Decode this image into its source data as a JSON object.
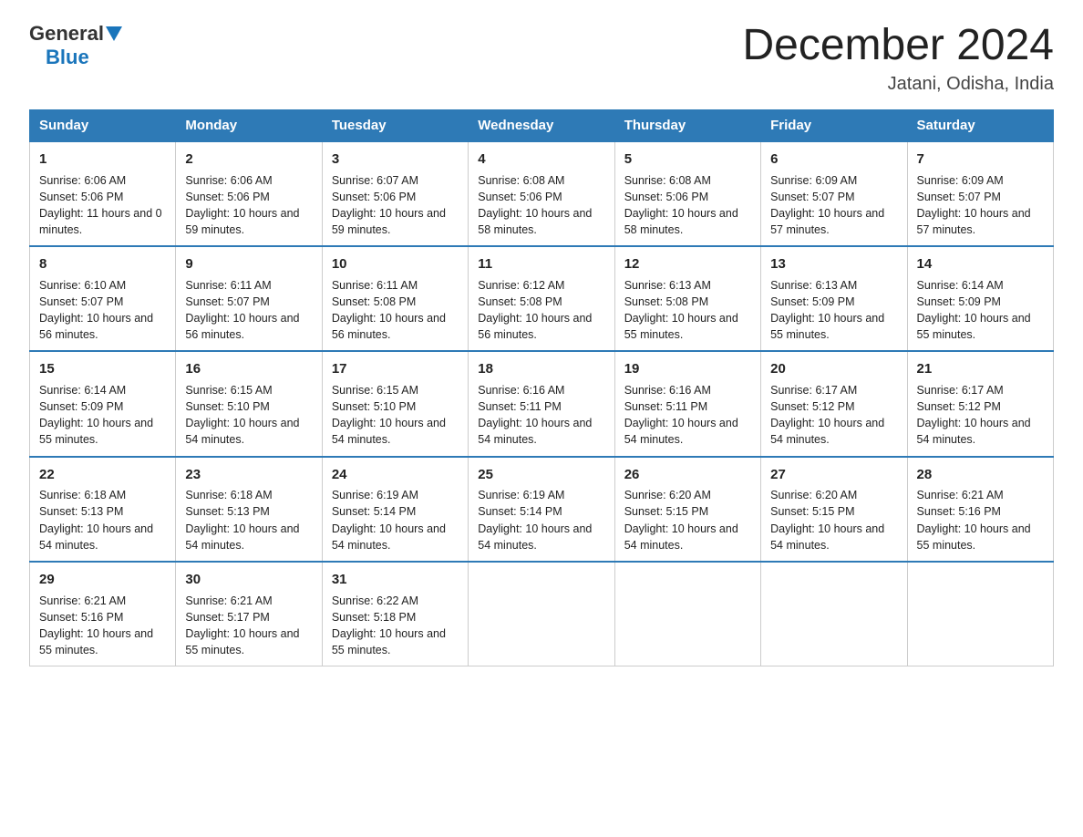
{
  "header": {
    "logo_general": "General",
    "logo_blue": "Blue",
    "month_title": "December 2024",
    "location": "Jatani, Odisha, India"
  },
  "days_of_week": [
    "Sunday",
    "Monday",
    "Tuesday",
    "Wednesday",
    "Thursday",
    "Friday",
    "Saturday"
  ],
  "weeks": [
    [
      {
        "day": "1",
        "sunrise": "6:06 AM",
        "sunset": "5:06 PM",
        "daylight": "11 hours and 0 minutes."
      },
      {
        "day": "2",
        "sunrise": "6:06 AM",
        "sunset": "5:06 PM",
        "daylight": "10 hours and 59 minutes."
      },
      {
        "day": "3",
        "sunrise": "6:07 AM",
        "sunset": "5:06 PM",
        "daylight": "10 hours and 59 minutes."
      },
      {
        "day": "4",
        "sunrise": "6:08 AM",
        "sunset": "5:06 PM",
        "daylight": "10 hours and 58 minutes."
      },
      {
        "day": "5",
        "sunrise": "6:08 AM",
        "sunset": "5:06 PM",
        "daylight": "10 hours and 58 minutes."
      },
      {
        "day": "6",
        "sunrise": "6:09 AM",
        "sunset": "5:07 PM",
        "daylight": "10 hours and 57 minutes."
      },
      {
        "day": "7",
        "sunrise": "6:09 AM",
        "sunset": "5:07 PM",
        "daylight": "10 hours and 57 minutes."
      }
    ],
    [
      {
        "day": "8",
        "sunrise": "6:10 AM",
        "sunset": "5:07 PM",
        "daylight": "10 hours and 56 minutes."
      },
      {
        "day": "9",
        "sunrise": "6:11 AM",
        "sunset": "5:07 PM",
        "daylight": "10 hours and 56 minutes."
      },
      {
        "day": "10",
        "sunrise": "6:11 AM",
        "sunset": "5:08 PM",
        "daylight": "10 hours and 56 minutes."
      },
      {
        "day": "11",
        "sunrise": "6:12 AM",
        "sunset": "5:08 PM",
        "daylight": "10 hours and 56 minutes."
      },
      {
        "day": "12",
        "sunrise": "6:13 AM",
        "sunset": "5:08 PM",
        "daylight": "10 hours and 55 minutes."
      },
      {
        "day": "13",
        "sunrise": "6:13 AM",
        "sunset": "5:09 PM",
        "daylight": "10 hours and 55 minutes."
      },
      {
        "day": "14",
        "sunrise": "6:14 AM",
        "sunset": "5:09 PM",
        "daylight": "10 hours and 55 minutes."
      }
    ],
    [
      {
        "day": "15",
        "sunrise": "6:14 AM",
        "sunset": "5:09 PM",
        "daylight": "10 hours and 55 minutes."
      },
      {
        "day": "16",
        "sunrise": "6:15 AM",
        "sunset": "5:10 PM",
        "daylight": "10 hours and 54 minutes."
      },
      {
        "day": "17",
        "sunrise": "6:15 AM",
        "sunset": "5:10 PM",
        "daylight": "10 hours and 54 minutes."
      },
      {
        "day": "18",
        "sunrise": "6:16 AM",
        "sunset": "5:11 PM",
        "daylight": "10 hours and 54 minutes."
      },
      {
        "day": "19",
        "sunrise": "6:16 AM",
        "sunset": "5:11 PM",
        "daylight": "10 hours and 54 minutes."
      },
      {
        "day": "20",
        "sunrise": "6:17 AM",
        "sunset": "5:12 PM",
        "daylight": "10 hours and 54 minutes."
      },
      {
        "day": "21",
        "sunrise": "6:17 AM",
        "sunset": "5:12 PM",
        "daylight": "10 hours and 54 minutes."
      }
    ],
    [
      {
        "day": "22",
        "sunrise": "6:18 AM",
        "sunset": "5:13 PM",
        "daylight": "10 hours and 54 minutes."
      },
      {
        "day": "23",
        "sunrise": "6:18 AM",
        "sunset": "5:13 PM",
        "daylight": "10 hours and 54 minutes."
      },
      {
        "day": "24",
        "sunrise": "6:19 AM",
        "sunset": "5:14 PM",
        "daylight": "10 hours and 54 minutes."
      },
      {
        "day": "25",
        "sunrise": "6:19 AM",
        "sunset": "5:14 PM",
        "daylight": "10 hours and 54 minutes."
      },
      {
        "day": "26",
        "sunrise": "6:20 AM",
        "sunset": "5:15 PM",
        "daylight": "10 hours and 54 minutes."
      },
      {
        "day": "27",
        "sunrise": "6:20 AM",
        "sunset": "5:15 PM",
        "daylight": "10 hours and 54 minutes."
      },
      {
        "day": "28",
        "sunrise": "6:21 AM",
        "sunset": "5:16 PM",
        "daylight": "10 hours and 55 minutes."
      }
    ],
    [
      {
        "day": "29",
        "sunrise": "6:21 AM",
        "sunset": "5:16 PM",
        "daylight": "10 hours and 55 minutes."
      },
      {
        "day": "30",
        "sunrise": "6:21 AM",
        "sunset": "5:17 PM",
        "daylight": "10 hours and 55 minutes."
      },
      {
        "day": "31",
        "sunrise": "6:22 AM",
        "sunset": "5:18 PM",
        "daylight": "10 hours and 55 minutes."
      },
      null,
      null,
      null,
      null
    ]
  ]
}
